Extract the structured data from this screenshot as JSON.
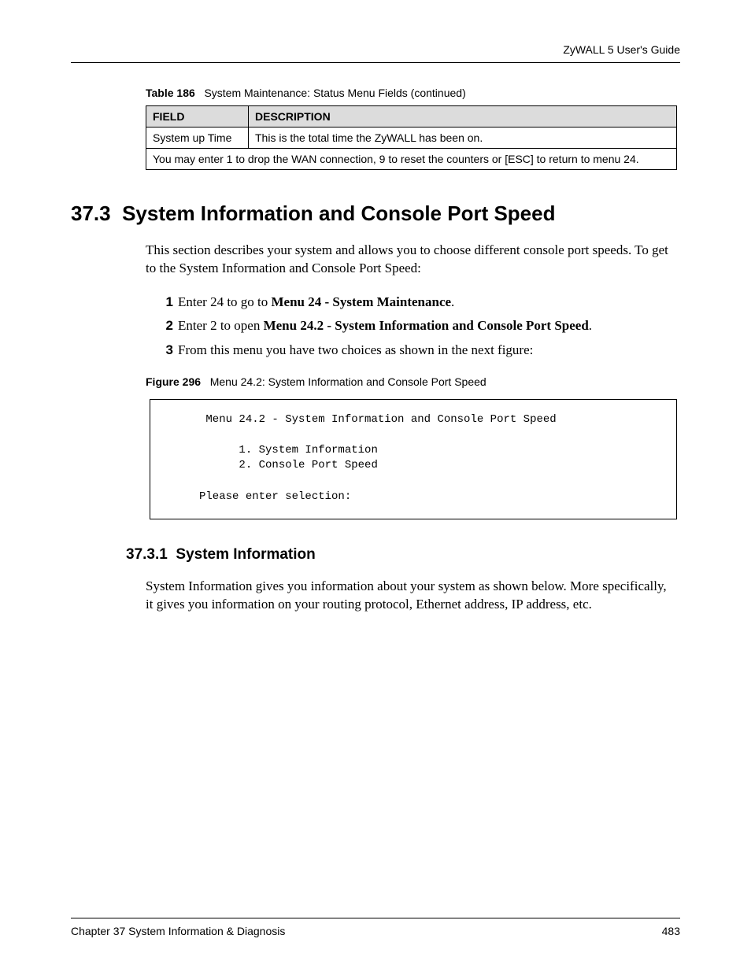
{
  "header": {
    "guide": "ZyWALL 5 User's Guide"
  },
  "table_caption": {
    "label": "Table 186",
    "text": "System Maintenance: Status Menu Fields (continued)"
  },
  "table": {
    "header_field": "FIELD",
    "header_desc": "DESCRIPTION",
    "row1_field": "System up Time",
    "row1_desc": "This is the total time the ZyWALL has been on.",
    "row2_span": "You may enter 1 to drop the WAN connection, 9 to reset the counters or [ESC] to return to menu 24."
  },
  "section": {
    "num": "37.3",
    "title": "System Information and Console Port Speed",
    "intro": "This section describes your system and allows you to choose different console port speeds. To get to the System Information and Console Port Speed:"
  },
  "steps": {
    "s1_num": "1",
    "s1_prefix": "Enter 24 to go to ",
    "s1_bold": "Menu 24 - System Maintenance",
    "s1_suffix": ".",
    "s2_num": "2",
    "s2_prefix": "Enter 2 to open ",
    "s2_bold": "Menu 24.2 - System Information and Console Port Speed",
    "s2_suffix": ".",
    "s3_num": "3",
    "s3_text": "From this menu you have two choices as shown in the next figure:"
  },
  "figure_caption": {
    "label": "Figure 296",
    "text": "Menu 24.2: System Information and Console Port Speed"
  },
  "menu_box": "      Menu 24.2 - System Information and Console Port Speed\n\n           1. System Information\n           2. Console Port Speed\n\n     Please enter selection:",
  "subsection": {
    "num": "37.3.1",
    "title": "System Information",
    "body": "System Information gives you information about your system as shown below. More specifically, it gives you information on your routing protocol, Ethernet address, IP address, etc."
  },
  "footer": {
    "chapter": "Chapter 37 System Information & Diagnosis",
    "page": "483"
  }
}
